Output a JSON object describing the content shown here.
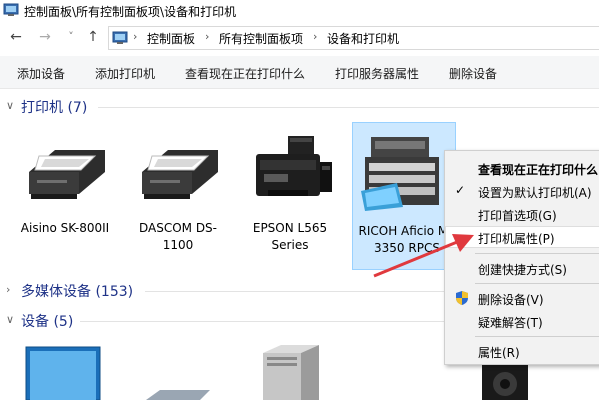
{
  "window": {
    "title": "控制面板\\所有控制面板项\\设备和打印机"
  },
  "nav": {
    "back_glyph": "←",
    "forward_glyph": "→",
    "recent_glyph": "˅",
    "up_glyph": "↑"
  },
  "address": {
    "crumbs": [
      "控制面板",
      "所有控制面板项",
      "设备和打印机"
    ],
    "separator": "›"
  },
  "toolbar": {
    "add_device": "添加设备",
    "add_printer": "添加打印机",
    "see_printing": "查看现在正在打印什么",
    "print_server_props": "打印服务器属性",
    "remove_device": "删除设备"
  },
  "sections": {
    "printers": {
      "title": "打印机 (7)",
      "expanded": true
    },
    "multimedia": {
      "title": "多媒体设备 (153)",
      "expanded": false
    },
    "devices": {
      "title": "设备 (5)",
      "expanded": true
    }
  },
  "printers": [
    {
      "name": "Aisino SK-800II"
    },
    {
      "name": "DASCOM DS-1100"
    },
    {
      "name": "EPSON L565 Series"
    },
    {
      "name": "RICOH Aficio MP 3350 RPCS",
      "selected": true
    }
  ],
  "context_menu": {
    "items": [
      {
        "label": "查看现在正在打印什么",
        "bold": true
      },
      {
        "label": "设置为默认打印机(A)",
        "checked": true
      },
      {
        "label": "打印首选项(G)"
      },
      {
        "label": "打印机属性(P)",
        "hover": true
      },
      {
        "label": "创建快捷方式(S)"
      },
      {
        "label": "删除设备(V)",
        "shield": true
      },
      {
        "label": "疑难解答(T)"
      },
      {
        "label": "属性(R)"
      }
    ]
  },
  "colors": {
    "section_title": "#1e3287",
    "selection": "#cce8ff",
    "arrow": "#e0393e"
  },
  "icons": {
    "check": "check-icon",
    "shield": "uac-shield-icon"
  }
}
